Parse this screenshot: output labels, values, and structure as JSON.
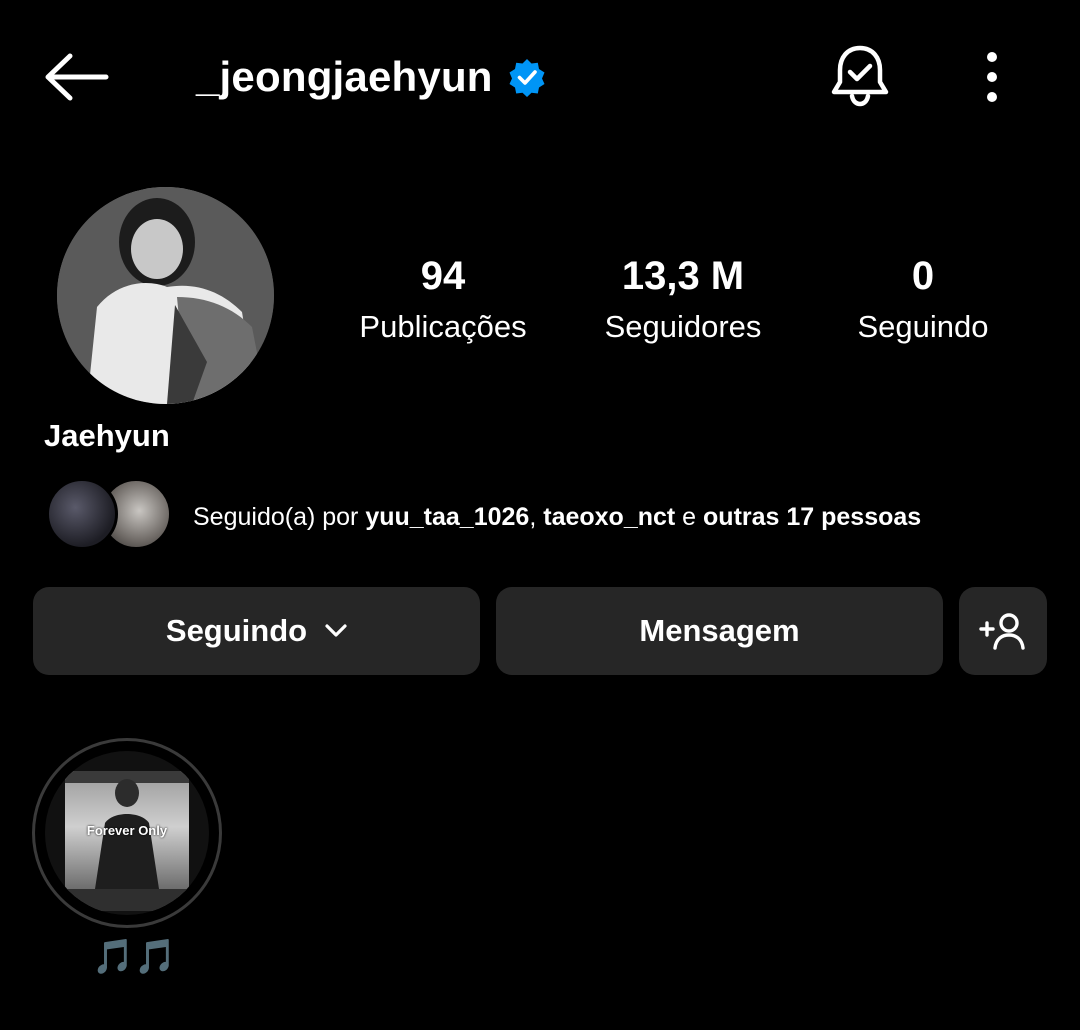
{
  "header": {
    "username": "_jeongjaehyun",
    "verified_icon": "verified-badge-icon",
    "back_icon": "arrow-left-icon",
    "notify_icon": "bell-check-icon",
    "more_icon": "more-vertical-icon",
    "verified_color": "#0095F6"
  },
  "profile": {
    "display_name": "Jaehyun",
    "stats": [
      {
        "value": "94",
        "label": "Publicações"
      },
      {
        "value": "13,3 M",
        "label": "Seguidores"
      },
      {
        "value": "0",
        "label": "Seguindo"
      }
    ]
  },
  "followed_by": {
    "prefix": "Seguido(a) por ",
    "user1": "yuu_taa_1026",
    "sep": ", ",
    "user2": "taeoxo_nct",
    "conj": " e ",
    "others": "outras 17 pessoas"
  },
  "actions": {
    "following_label": "Seguindo",
    "message_label": "Mensagem",
    "add_icon": "add-person-icon"
  },
  "highlights": [
    {
      "label": "🎵🎵",
      "cover_text": "Forever Only"
    }
  ],
  "colors": {
    "background": "#000000",
    "button": "#262626",
    "accent": "#1E9CF0"
  }
}
